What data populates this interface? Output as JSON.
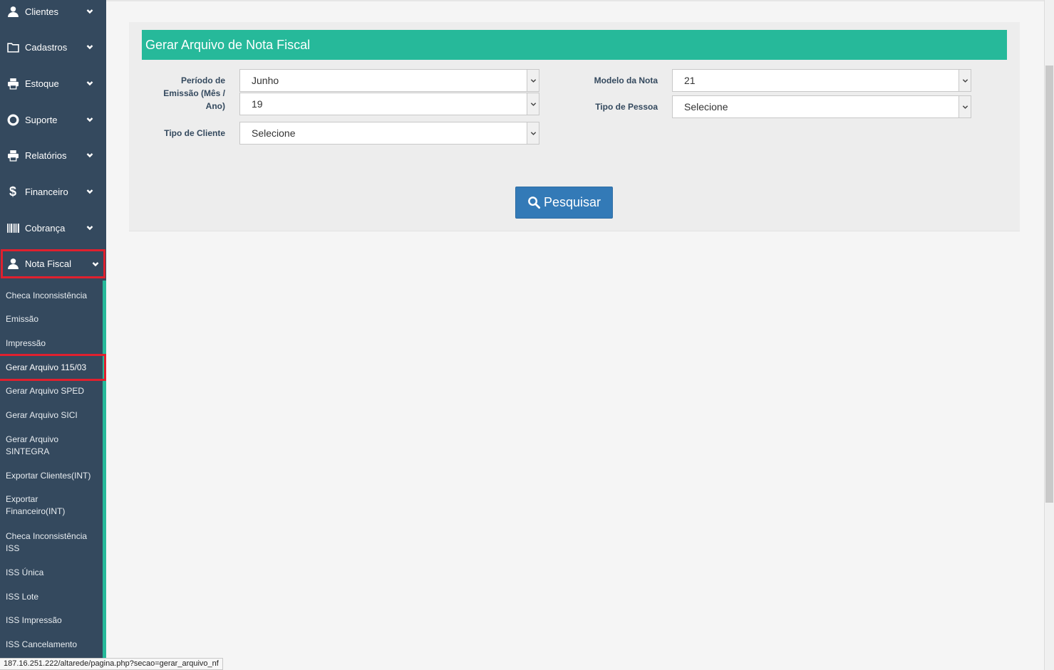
{
  "sidebar": {
    "items": [
      {
        "label": "Clientes",
        "icon": "user-icon"
      },
      {
        "label": "Cadastros",
        "icon": "folder-icon"
      },
      {
        "label": "Estoque",
        "icon": "printer-icon"
      },
      {
        "label": "Suporte",
        "icon": "lifebuoy-icon"
      },
      {
        "label": "Relatórios",
        "icon": "printer-icon"
      },
      {
        "label": "Financeiro",
        "icon": "dollar-icon"
      },
      {
        "label": "Cobrança",
        "icon": "barcode-icon"
      },
      {
        "label": "Nota Fiscal",
        "icon": "user-icon",
        "active": true
      }
    ],
    "submenu": [
      "Checa Inconsistência",
      "Emissão",
      "Impressão",
      "Gerar Arquivo 115/03",
      "Gerar Arquivo SPED",
      "Gerar Arquivo SICI",
      "Gerar Arquivo SINTEGRA",
      "Exportar Clientes(INT)",
      "Exportar Financeiro(INT)",
      "Checa Inconsistência ISS",
      "ISS Única",
      "ISS Lote",
      "ISS Impressão",
      "ISS Cancelamento"
    ],
    "submenu_active": "Gerar Arquivo 115/03",
    "colors": {
      "background": "#34495e",
      "accent": "#26b99a",
      "highlight": "#e0202e"
    }
  },
  "panel": {
    "title": "Gerar Arquivo de Nota Fiscal",
    "periodo_label": "Período de Emissão (Mês / Ano)",
    "mes_value": "Junho",
    "ano_value": "19",
    "tipo_cliente_label": "Tipo de Cliente",
    "tipo_cliente_value": "Selecione",
    "modelo_label": "Modelo da Nota",
    "modelo_value": "21",
    "tipo_pessoa_label": "Tipo de Pessoa",
    "tipo_pessoa_value": "Selecione",
    "search_button": "Pesquisar",
    "colors": {
      "header": "#26b99a",
      "button": "#337ab7"
    }
  },
  "statusbar": {
    "url": "187.16.251.222/altarede/pagina.php?secao=gerar_arquivo_nf"
  }
}
